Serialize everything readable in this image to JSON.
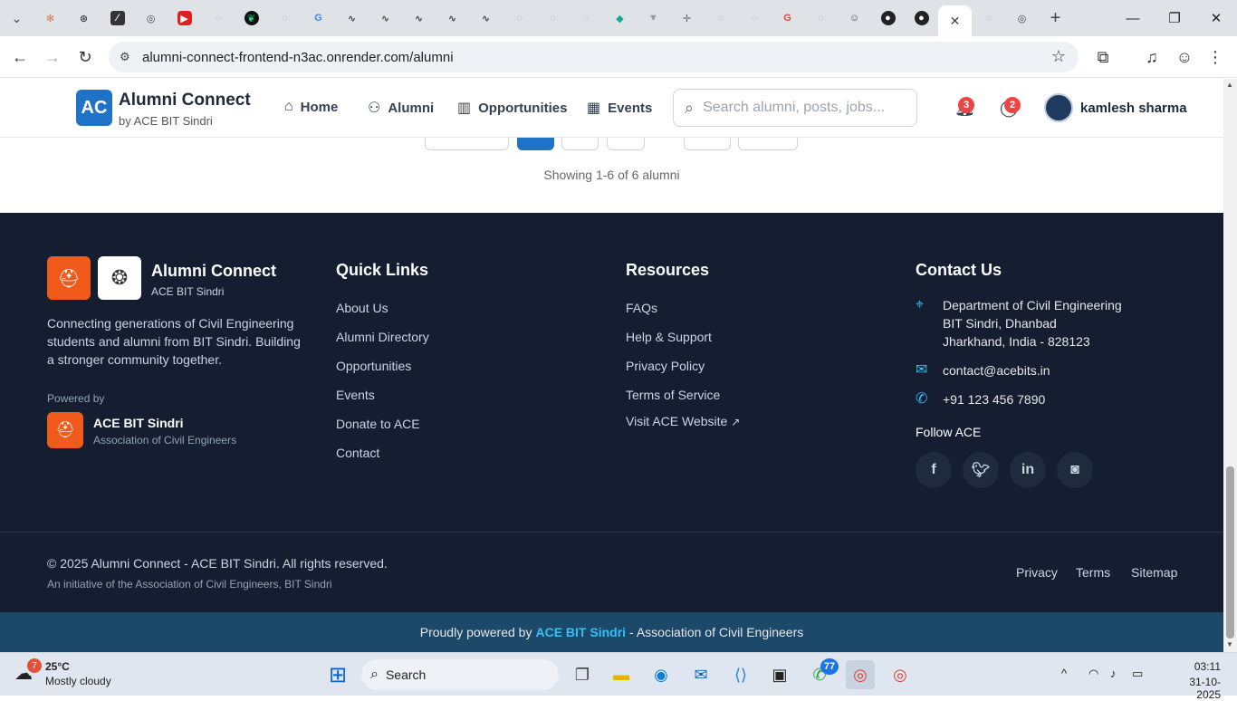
{
  "browser": {
    "url": "alumni-connect-frontend-n3ac.onrender.com/alumni",
    "tab_icons": [
      "tab-list-icon",
      "claude-icon",
      "chatgpt-icon",
      "tool-icon",
      "chrome-icon",
      "youtube-icon",
      "blank-icon",
      "leaf-icon",
      "blank-icon",
      "google-icon",
      "wave-icon",
      "wave-icon",
      "wave-icon",
      "wave-icon",
      "wave-icon",
      "blank-icon",
      "blank-icon",
      "blank-icon",
      "diamond-icon",
      "feather-icon",
      "cross-icon",
      "blank-icon",
      "blank-icon",
      "google-icon",
      "blank-icon",
      "person-icon",
      "github-icon",
      "github-icon",
      "active-tab-icon",
      "blank-icon",
      "chrome-icon"
    ]
  },
  "nav": {
    "logo_text": "AC",
    "brand_title": "Alumni Connect",
    "brand_sub": "by ACE BIT Sindri",
    "home": "Home",
    "alumni": "Alumni",
    "opportunities": "Opportunities",
    "events": "Events",
    "search_placeholder": "Search alumni, posts, jobs...",
    "notif_count": "3",
    "msg_count": "2",
    "user_name": "kamlesh sharma"
  },
  "listing": {
    "showing": "Showing 1-6 of 6 alumni"
  },
  "footer": {
    "brand_title": "Alumni Connect",
    "brand_sub": "ACE BIT Sindri",
    "description": "Connecting generations of Civil Engineering students and alumni from BIT Sindri. Building a stronger community together.",
    "powered_by": "Powered by",
    "powered_title": "ACE BIT Sindri",
    "powered_sub": "Association of Civil Engineers",
    "quick_links_title": "Quick Links",
    "quick_links": [
      "About Us",
      "Alumni Directory",
      "Opportunities",
      "Events",
      "Donate to ACE",
      "Contact"
    ],
    "resources_title": "Resources",
    "resources": [
      "FAQs",
      "Help & Support",
      "Privacy Policy",
      "Terms of Service",
      "Visit ACE Website"
    ],
    "contact_title": "Contact Us",
    "address_line1": "Department of Civil Engineering",
    "address_line2": "BIT Sindri, Dhanbad",
    "address_line3": "Jharkhand, India - 828123",
    "email": "contact@acebits.in",
    "phone": "+91 123 456 7890",
    "follow_title": "Follow ACE",
    "copyright": "© 2025 Alumni Connect - ACE BIT Sindri. All rights reserved.",
    "initiative": "An initiative of the Association of Civil Engineers, BIT Sindri",
    "bottom_links": [
      "Privacy",
      "Terms",
      "Sitemap"
    ],
    "powered_bar_prefix": "Proudly powered by",
    "powered_bar_highlight": "ACE BIT Sindri",
    "powered_bar_suffix": "- Association of Civil Engineers"
  },
  "taskbar": {
    "weather_badge": "7",
    "temperature": "25°C",
    "condition": "Mostly cloudy",
    "search_label": "Search",
    "whatsapp_badge": "77",
    "time": "03:11",
    "date": "31-10-2025"
  }
}
